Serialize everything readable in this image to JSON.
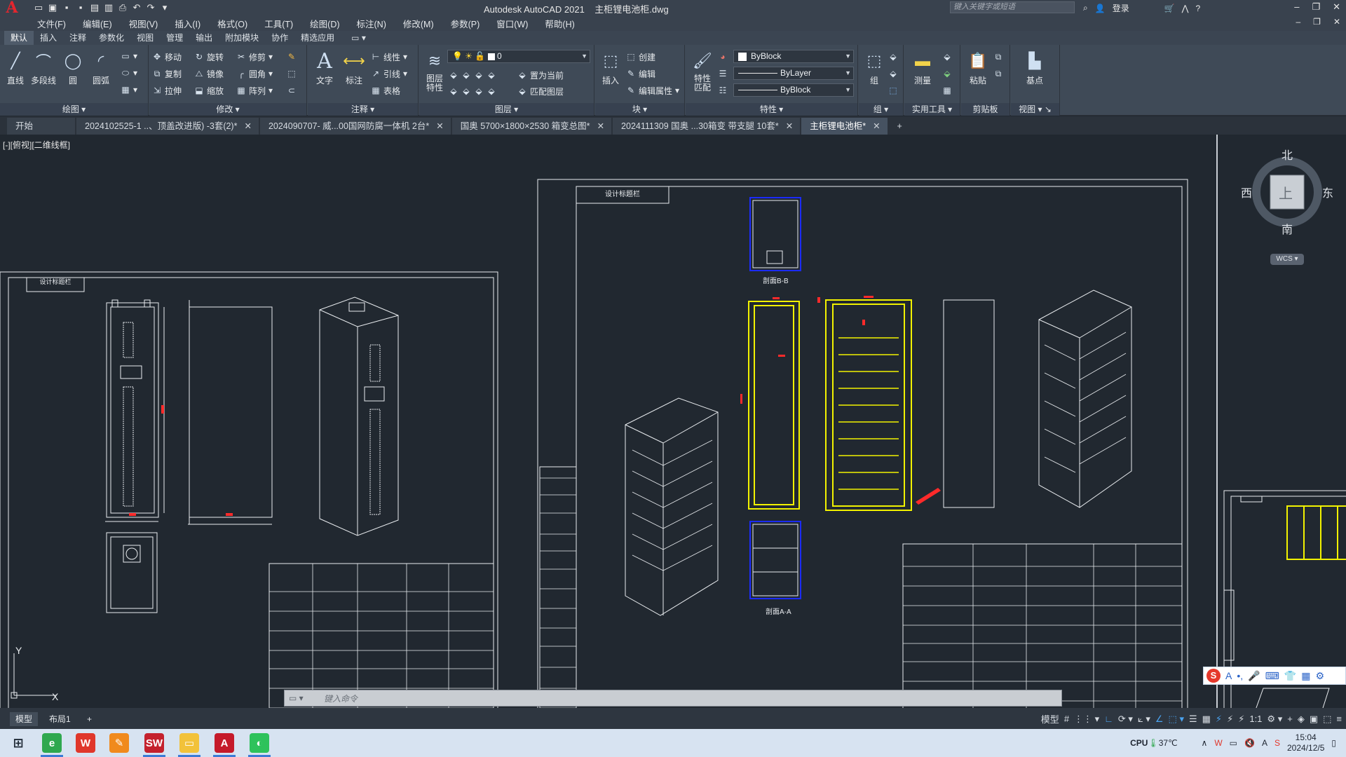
{
  "app": {
    "logo": "A",
    "title": "Autodesk AutoCAD 2021",
    "file_name": "主柜锂电池柜.dwg",
    "search_placeholder": "键入关键字或短语",
    "login": "登录"
  },
  "menu": [
    "文件(F)",
    "编辑(E)",
    "视图(V)",
    "插入(I)",
    "格式(O)",
    "工具(T)",
    "绘图(D)",
    "标注(N)",
    "修改(M)",
    "参数(P)",
    "窗口(W)",
    "帮助(H)"
  ],
  "ribbon_tabs": [
    "默认",
    "插入",
    "注释",
    "参数化",
    "视图",
    "管理",
    "输出",
    "附加模块",
    "协作",
    "精选应用"
  ],
  "ribbon": {
    "draw": {
      "title": "绘图",
      "line": "直线",
      "polyline": "多段线",
      "circle": "圆",
      "arc": "圆弧"
    },
    "modify": {
      "title": "修改",
      "move": "移动",
      "rotate": "旋转",
      "trim": "修剪",
      "copy": "复制",
      "mirror": "镜像",
      "fillet": "圆角",
      "stretch": "拉伸",
      "scale": "缩放",
      "array": "阵列"
    },
    "annotation": {
      "title": "注释",
      "text": "文字",
      "dimension": "标注",
      "linear": "线性",
      "leader": "引线",
      "table": "表格"
    },
    "layers": {
      "title": "图层",
      "props": "图层\n特性",
      "current_layer": "0",
      "make_current": "置为当前",
      "match_layer": "匹配图层"
    },
    "block": {
      "title": "块",
      "insert": "插入",
      "create": "创建",
      "edit": "编辑",
      "edit_attr": "编辑属性"
    },
    "properties": {
      "title": "特性",
      "match": "特性\n匹配",
      "color": "ByBlock",
      "linetype": "ByLayer",
      "lineweight": "ByBlock"
    },
    "groups": {
      "title": "组",
      "group": "组"
    },
    "utilities": {
      "title": "实用工具",
      "measure": "测量"
    },
    "clipboard": {
      "title": "剪贴板",
      "paste": "粘贴"
    },
    "view": {
      "title": "视图",
      "base": "基点"
    }
  },
  "doc_tabs": [
    {
      "label": "开始",
      "active": false,
      "closable": false
    },
    {
      "label": "2024102525-1 ..、顶盖改进版) -3套(2)*",
      "active": false,
      "closable": true
    },
    {
      "label": "2024090707- 威...00国网防腐一体机 2台*",
      "active": false,
      "closable": true
    },
    {
      "label": "国奥 5700×1800×2530 箱变总图*",
      "active": false,
      "closable": true
    },
    {
      "label": "2024111309 国奥 ...30箱变 带支腿 10套*",
      "active": false,
      "closable": true
    },
    {
      "label": "主柜锂电池柜*",
      "active": true,
      "closable": true
    }
  ],
  "viewport": {
    "label": "[-][俯视][二维线框]",
    "compass": {
      "north": "北",
      "south": "南",
      "east": "东",
      "west": "西",
      "top": "上"
    },
    "wcs": "WCS"
  },
  "drawing": {
    "left_title": "设计标题栏",
    "right_title": "设计标题栏",
    "section_bb": "剖面B-B",
    "section_aa": "剖面A-A",
    "ucs_y": "Y",
    "ucs_x": "X"
  },
  "command": {
    "placeholder": "键入命令"
  },
  "layout_tabs": [
    "模型",
    "布局1"
  ],
  "status": {
    "model": "模型",
    "scale": "1:1"
  },
  "taskbar": {
    "cpu": "CPU",
    "temp": "37℃",
    "time": "15:04",
    "date": "2024/12/5"
  },
  "colors": {
    "canvas": "#212830",
    "ribbon": "#3f4a57",
    "drawing_yellow": "#f2f200",
    "drawing_blue": "#1b2bff",
    "drawing_red": "#ff2a2a",
    "drawing_white": "#e9ecef"
  }
}
